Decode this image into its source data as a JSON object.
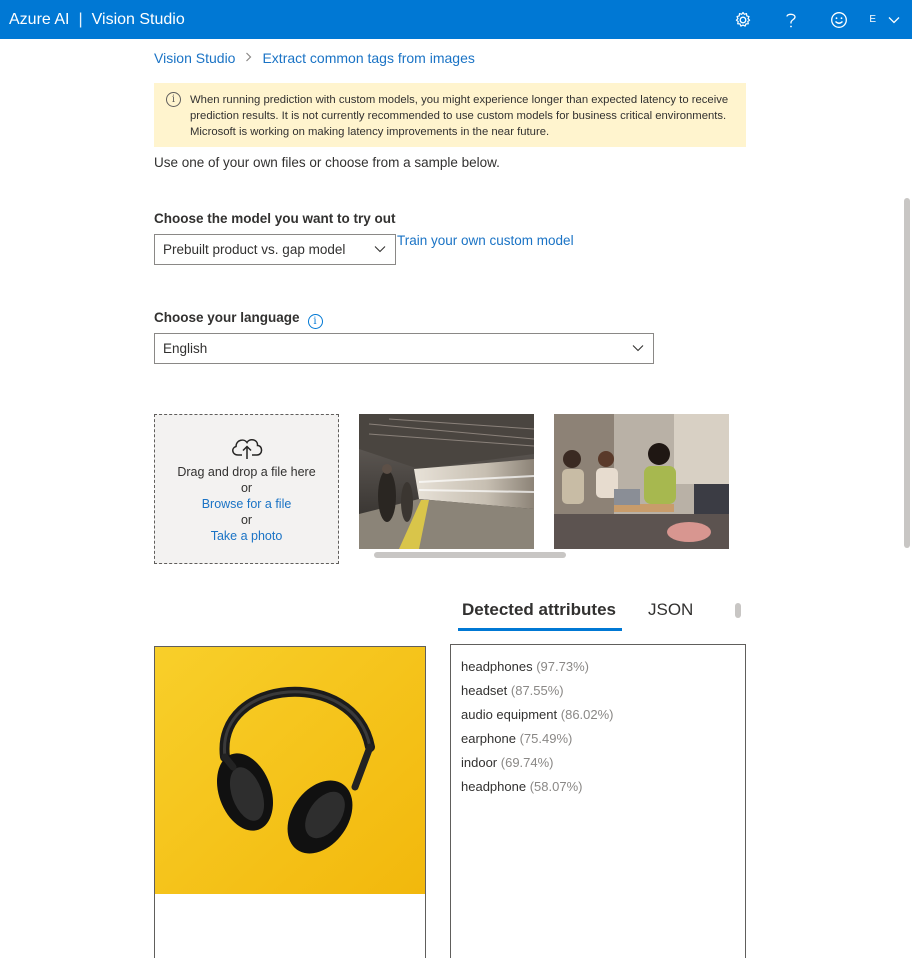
{
  "topbar": {
    "brand_left": "Azure AI",
    "brand_sep": "|",
    "brand_right": "Vision Studio",
    "icons": [
      "gear-icon",
      "help-icon",
      "feedback-smiley-icon"
    ],
    "account_initial": "E"
  },
  "breadcrumb": {
    "root": "Vision Studio",
    "current": "Extract common tags from images"
  },
  "warning": {
    "text": "When running prediction with custom models, you might experience longer than expected latency to receive prediction results.  It is not currently recommended to use custom models for business critical environments. Microsoft is working on making latency improvements in the near future."
  },
  "intro": "Use one of your own files or choose from a sample below.",
  "model": {
    "label": "Choose the model you want to try out",
    "selected": "Prebuilt product vs. gap model",
    "train_link": "Train your own custom model"
  },
  "language": {
    "label": "Choose your language",
    "selected": "English"
  },
  "dropzone": {
    "drag_text": "Drag and drop a file here",
    "or1": "or",
    "browse": "Browse for a file",
    "or2": "or",
    "photo": "Take a photo"
  },
  "tabs": {
    "detected": "Detected attributes",
    "json": "JSON"
  },
  "attributes": [
    {
      "name": "headphones",
      "pct": "(97.73%)"
    },
    {
      "name": "headset",
      "pct": "(87.55%)"
    },
    {
      "name": "audio equipment",
      "pct": "(86.02%)"
    },
    {
      "name": "earphone",
      "pct": "(75.49%)"
    },
    {
      "name": "indoor",
      "pct": "(69.74%)"
    },
    {
      "name": "headphone",
      "pct": "(58.07%)"
    }
  ],
  "colors": {
    "topbar": "#0078d4",
    "link": "#1a73c5",
    "warning_bg": "#fff4ce",
    "result_bg": "#f7c614"
  }
}
